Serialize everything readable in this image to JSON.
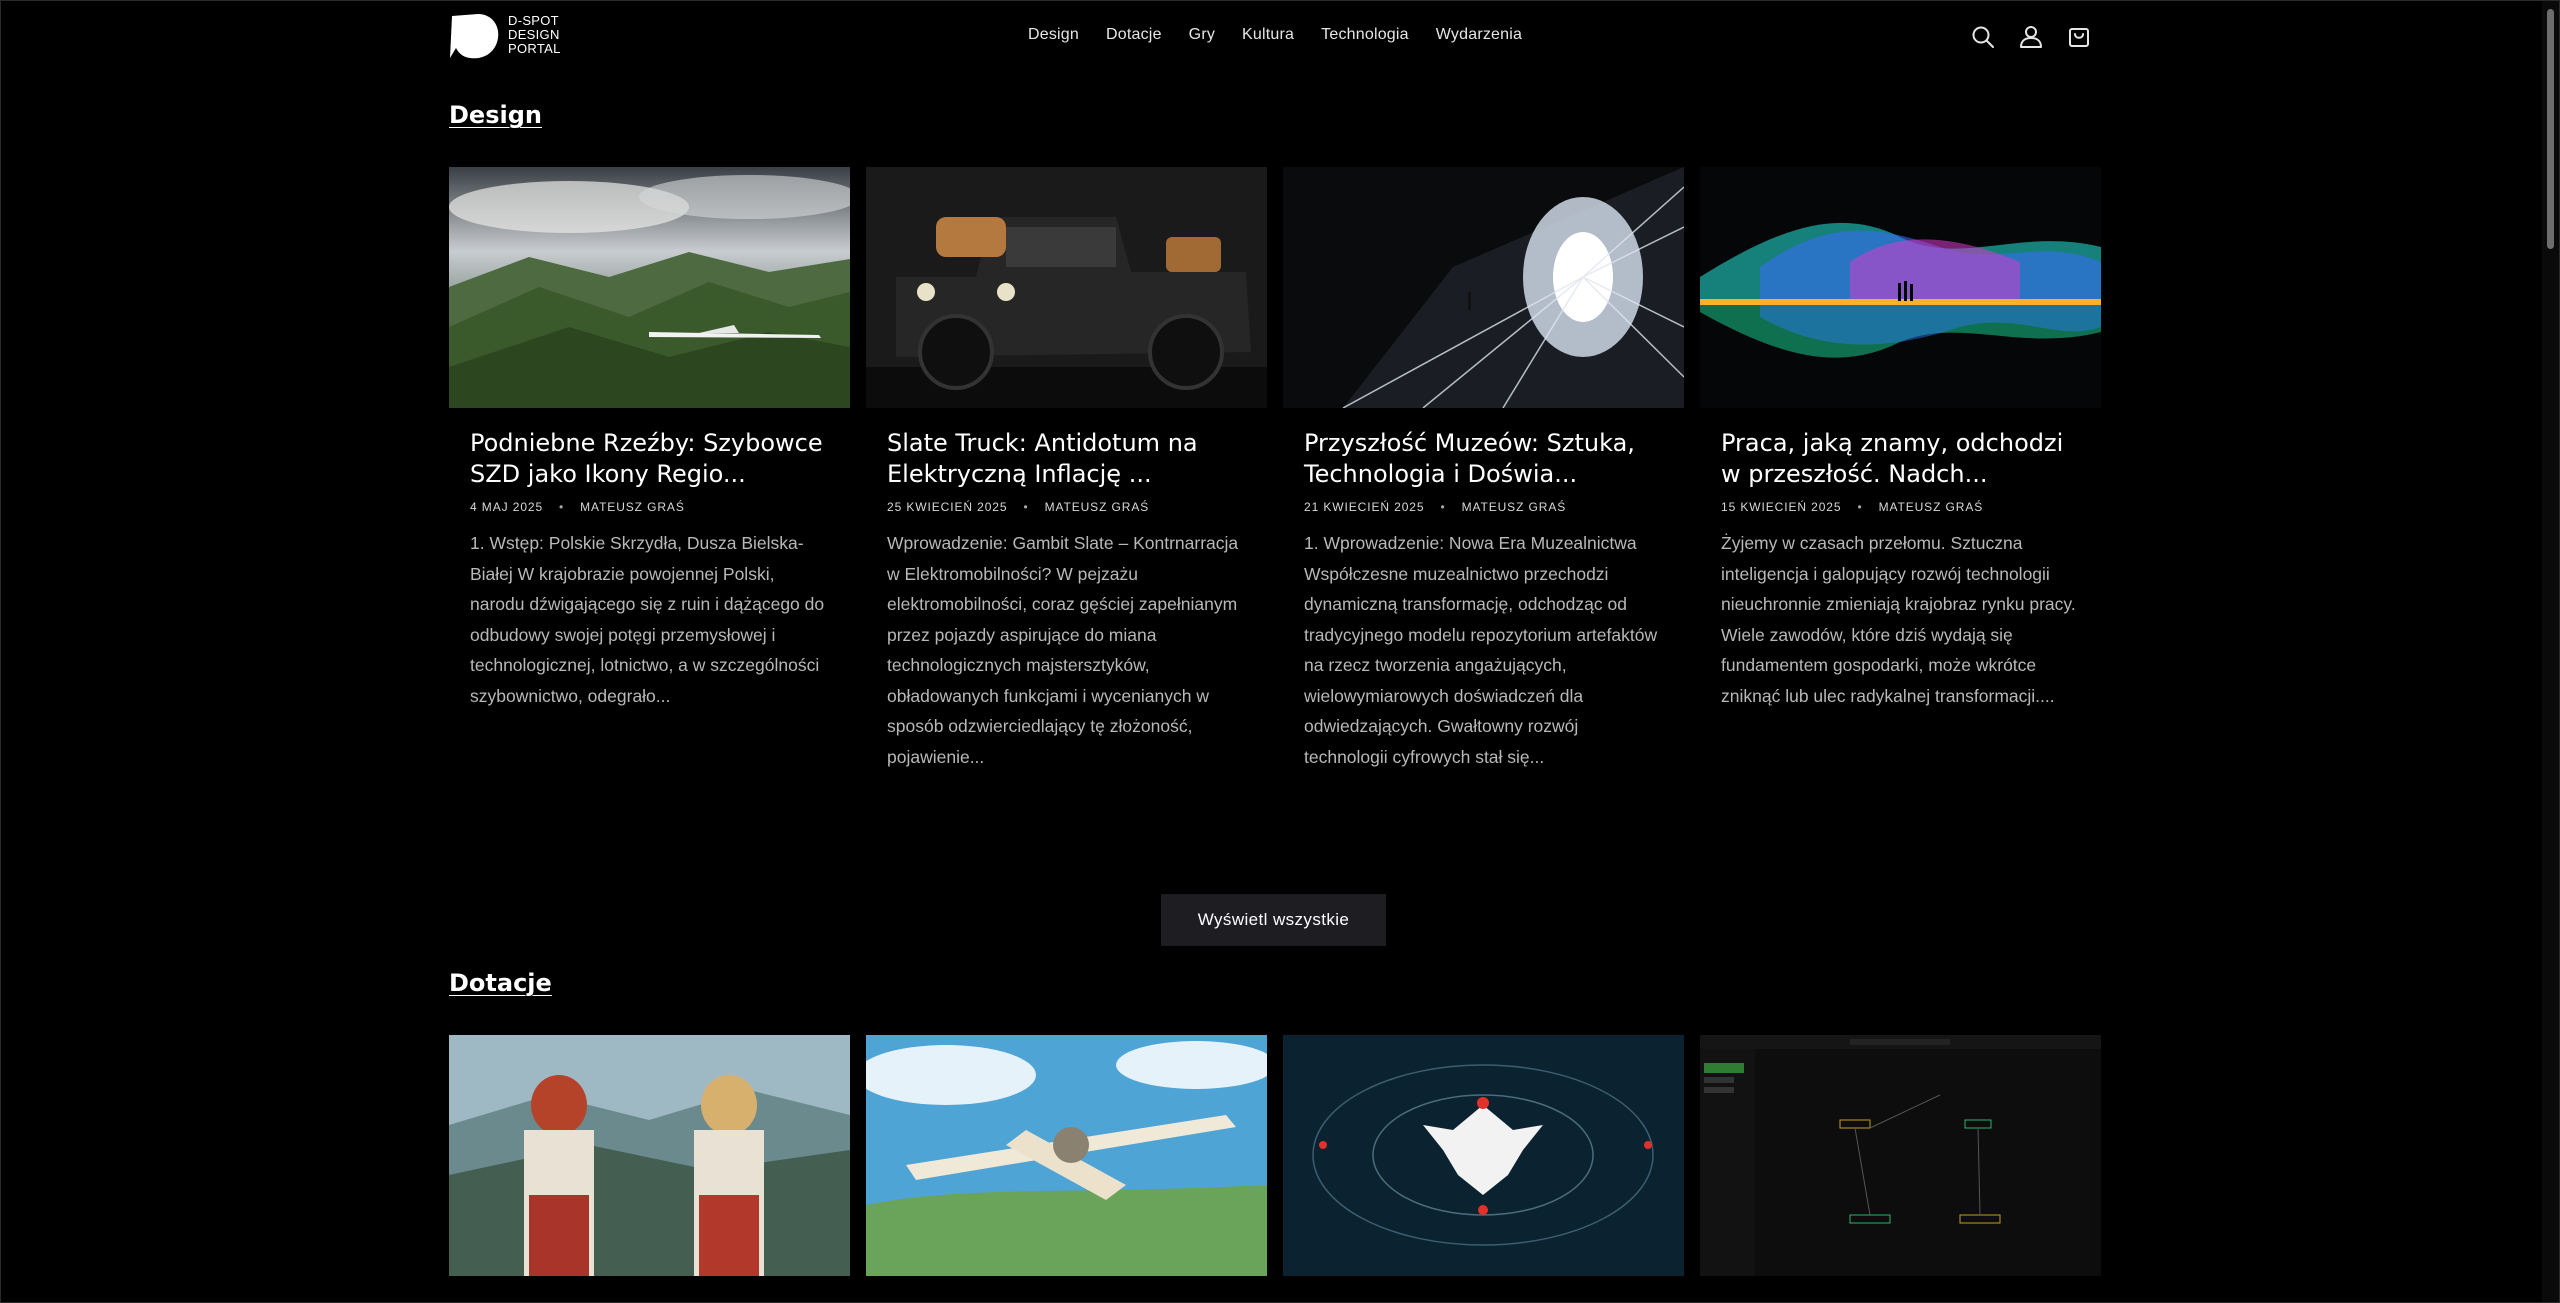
{
  "header": {
    "logo_lines": [
      "D-SPOT",
      "DESIGN",
      "PORTAL"
    ],
    "nav": [
      "Design",
      "Dotacje",
      "Gry",
      "Kultura",
      "Technologia",
      "Wydarzenia"
    ],
    "icons": [
      "search-icon",
      "account-icon",
      "cart-icon"
    ]
  },
  "sections": [
    {
      "title": "Design",
      "button": "Wyświetl wszystkie",
      "cards": [
        {
          "title": "Podniebne Rzeźby: Szybowce SZD jako Ikony Regio...",
          "date": "4 MAJ 2025",
          "author": "MATEUSZ GRAŚ",
          "excerpt": "1. Wstęp: Polskie Skrzydła, Dusza Bielska-Białej W krajobrazie powojennej Polski, narodu dźwigającego się z ruin i dążącego do odbudowy swojej potęgi przemysłowej i technologicznej, lotnictwo, a w szczególności szybownictwo, odegrało...",
          "image": "glider-over-mountains"
        },
        {
          "title": "Slate Truck: Antidotum na Elektryczną Inflację ...",
          "date": "25 KWIECIEŃ 2025",
          "author": "MATEUSZ GRAŚ",
          "excerpt": "Wprowadzenie: Gambit Slate – Kontrnarracja w Elektromobilności? W pejzażu elektromobilności, coraz gęściej zapełnianym przez pojazdy aspirujące do miana technologicznych majstersztyków, obładowanych funkcjami i wycenianych w sposób odzwierciedlający tę złożoność, pojawienie...",
          "image": "black-pickup-truck"
        },
        {
          "title": "Przyszłość Muzeów: Sztuka, Technologia i Doświa...",
          "date": "21 KWIECIEŃ 2025",
          "author": "MATEUSZ GRAŚ",
          "excerpt": "1. Wprowadzenie: Nowa Era Muzealnictwa Współczesne muzealnictwo przechodzi dynamiczną transformację, odchodząc od tradycyjnego modelu repozytorium artefaktów na rzecz tworzenia angażujących, wielowymiarowych doświadczeń dla odwiedzających. Gwałtowny rozwój technologii cyfrowych stał się...",
          "image": "digital-tunnel"
        },
        {
          "title": "Praca, jaką znamy, odchodzi w przeszłość. Nadch...",
          "date": "15 KWIECIEŃ 2025",
          "author": "MATEUSZ GRAŚ",
          "excerpt": "Żyjemy w czasach przełomu. Sztuczna inteligencja i galopujący rozwój technologii nieuchronnie zmieniają krajobraz rynku pracy. Wiele zawodów, które dziś wydają się fundamentem gospodarki, może wkrótce zniknąć lub ulec radykalnej transformacji....",
          "image": "neon-waves"
        }
      ]
    },
    {
      "title": "Dotacje",
      "cards": [
        {
          "image": "folk-women-mountains"
        },
        {
          "image": "illustrated-plane"
        },
        {
          "image": "polish-eagle-radar"
        },
        {
          "image": "flow-diagram-app"
        }
      ]
    }
  ],
  "colors": {
    "background": "#000000",
    "text": "#ffffff",
    "muted": "#b8b8b8",
    "button_bg": "#1e1e22"
  }
}
